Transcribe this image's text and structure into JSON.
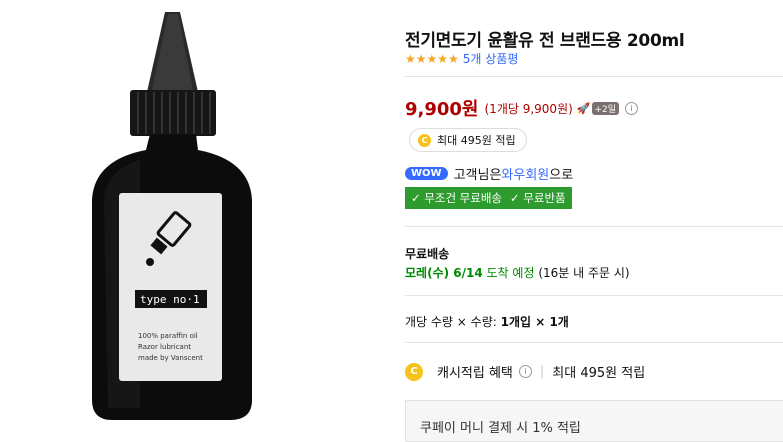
{
  "product": {
    "title": "전기면도기 윤활유 전 브랜드용 200ml",
    "stars": "★★★★★",
    "review_count": "5개 상품평",
    "label_brand": "type no·1",
    "label_lines": [
      "100% paraffin oil",
      "Razor lubricant",
      "made by Vanscent"
    ]
  },
  "price": {
    "main": "9,900원",
    "unit": "(1개당 9,900원)",
    "rocket_icon": "🚀",
    "badge": "+2일",
    "info": "i"
  },
  "reward": {
    "coin": "C",
    "text": "최대 495원 적립"
  },
  "wow": {
    "badge": "WOW",
    "prefix": "고객님은 ",
    "member": "와우회원",
    "suffix": "으로"
  },
  "free": {
    "shipping": "✓ 무조건 무료배송",
    "returns": "✓ 무료반품"
  },
  "shipping": {
    "title": "무료배송",
    "date_a": "모레(수) 6/14",
    "date_b": " 도착 예정",
    "note": " (16분 내 주문 시)"
  },
  "quantity": {
    "label": "개당 수량 × 수량: ",
    "value": "1개입 × 1개"
  },
  "cash": {
    "coin": "C",
    "label": "캐시적립 혜택",
    "info": "i",
    "sep": "|",
    "value": "최대 495원 적립"
  },
  "coupay": {
    "text": "쿠페이 머니 결제 시 1% 적립"
  }
}
